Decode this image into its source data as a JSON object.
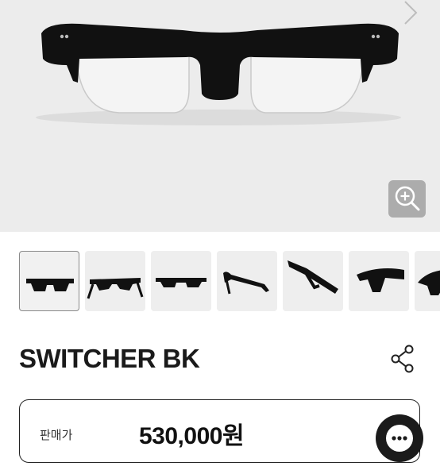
{
  "product": {
    "name": "SWITCHER BK",
    "price_label": "판매가",
    "price_value": "530,000원"
  },
  "gallery": {
    "thumbnail_count": 7,
    "active_index": 0
  },
  "icons": {
    "next": "chevron-right-icon",
    "zoom": "zoom-in-icon",
    "share": "share-icon",
    "chat": "chat-icon"
  }
}
